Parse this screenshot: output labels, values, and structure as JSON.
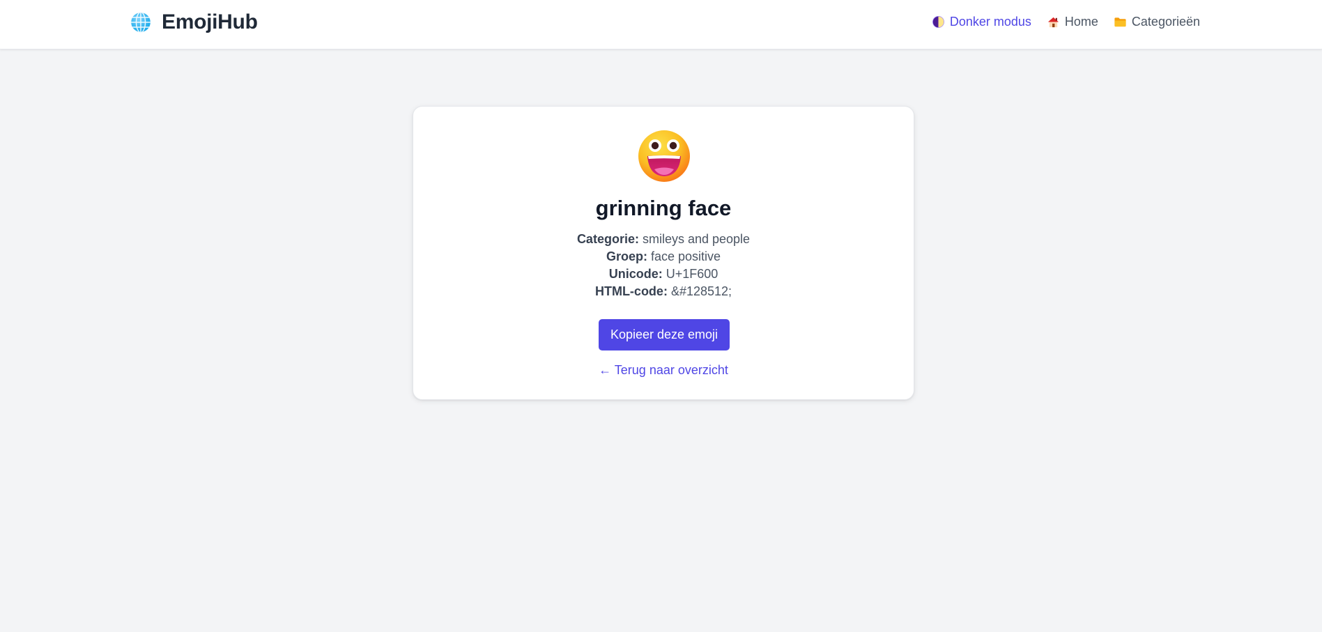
{
  "header": {
    "brand": "EmojiHub",
    "nav": {
      "dark_mode": "Donker modus",
      "home": "Home",
      "categories": "Categorieën"
    }
  },
  "emoji": {
    "name": "grinning face",
    "category_label": "Categorie:",
    "category_value": "smileys and people",
    "group_label": "Groep:",
    "group_value": "face positive",
    "unicode_label": "Unicode:",
    "unicode_value": "U+1F600",
    "html_label": "HTML-code:",
    "html_value": "&#128512;"
  },
  "actions": {
    "copy_label": "Kopieer deze emoji",
    "back_label": "← Terug naar overzicht"
  },
  "icons": {
    "brand": "globe-icon",
    "dark_mode": "half-moon-icon",
    "home": "house-icon",
    "categories": "folder-icon",
    "emoji": "grinning-face-emoji"
  },
  "colors": {
    "accent": "#4f46e5",
    "background": "#f3f4f6",
    "card": "#ffffff",
    "heading": "#111827"
  }
}
